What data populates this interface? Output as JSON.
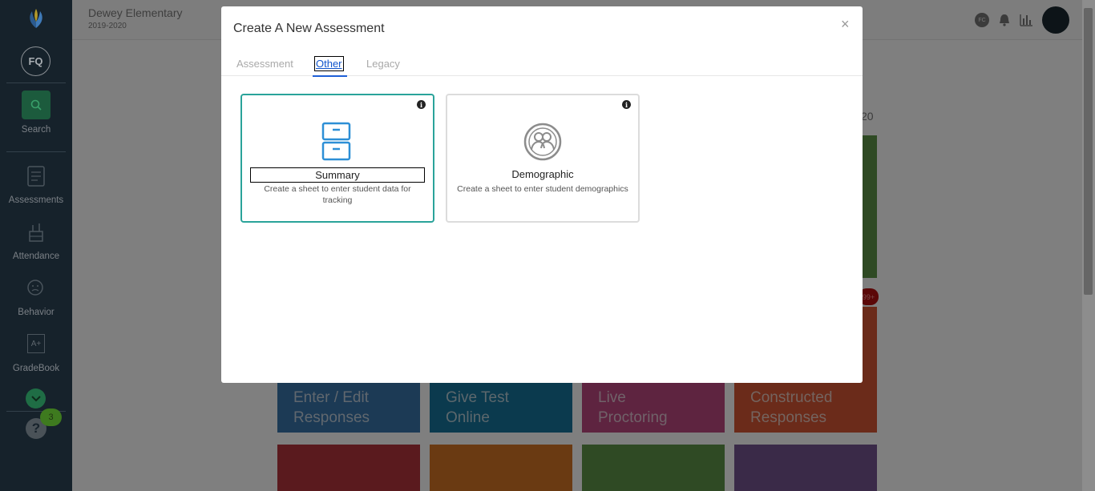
{
  "sidebar": {
    "initials": "FQ",
    "items": [
      {
        "label": "Search",
        "icon": "search-icon"
      },
      {
        "label": "Assessments",
        "icon": "clipboard-icon"
      },
      {
        "label": "Attendance",
        "icon": "attendance-icon"
      },
      {
        "label": "Behavior",
        "icon": "behavior-face-icon"
      },
      {
        "label": "GradeBook",
        "icon": "grade-a-plus-icon"
      }
    ],
    "help_badge": "3"
  },
  "header": {
    "school_name": "Dewey Elementary",
    "school_year": "2019-2020",
    "user_initials": "FC"
  },
  "background": {
    "year_fragment": "20",
    "badge": "99+",
    "tiles": [
      {
        "line1": "Enter / Edit",
        "line2": "Responses",
        "color": "#1c3a55"
      },
      {
        "line1": "Give Test",
        "line2": "Online",
        "color": "#0b3a4e"
      },
      {
        "line1": "Live",
        "line2": "Proctoring",
        "color": "#5e2440"
      },
      {
        "line1": "Constructed",
        "line2": "Responses",
        "color": "#6b2b1a"
      }
    ]
  },
  "modal": {
    "title": "Create A New Assessment",
    "close_label": "×",
    "tabs": [
      {
        "label": "Assessment",
        "active": false
      },
      {
        "label": "Other",
        "active": true
      },
      {
        "label": "Legacy",
        "active": false
      }
    ],
    "cards": [
      {
        "title": "Summary",
        "description": "Create a sheet to enter student data for tracking",
        "icon": "file-cabinet-icon",
        "selected": true
      },
      {
        "title": "Demographic",
        "description": "Create a sheet to enter student demographics",
        "icon": "people-circle-icon",
        "selected": false
      }
    ],
    "info_label": "i"
  },
  "colors": {
    "accent": "#2aa39a",
    "tab_active": "#1155cc",
    "icon_blue": "#2d8fd6"
  }
}
